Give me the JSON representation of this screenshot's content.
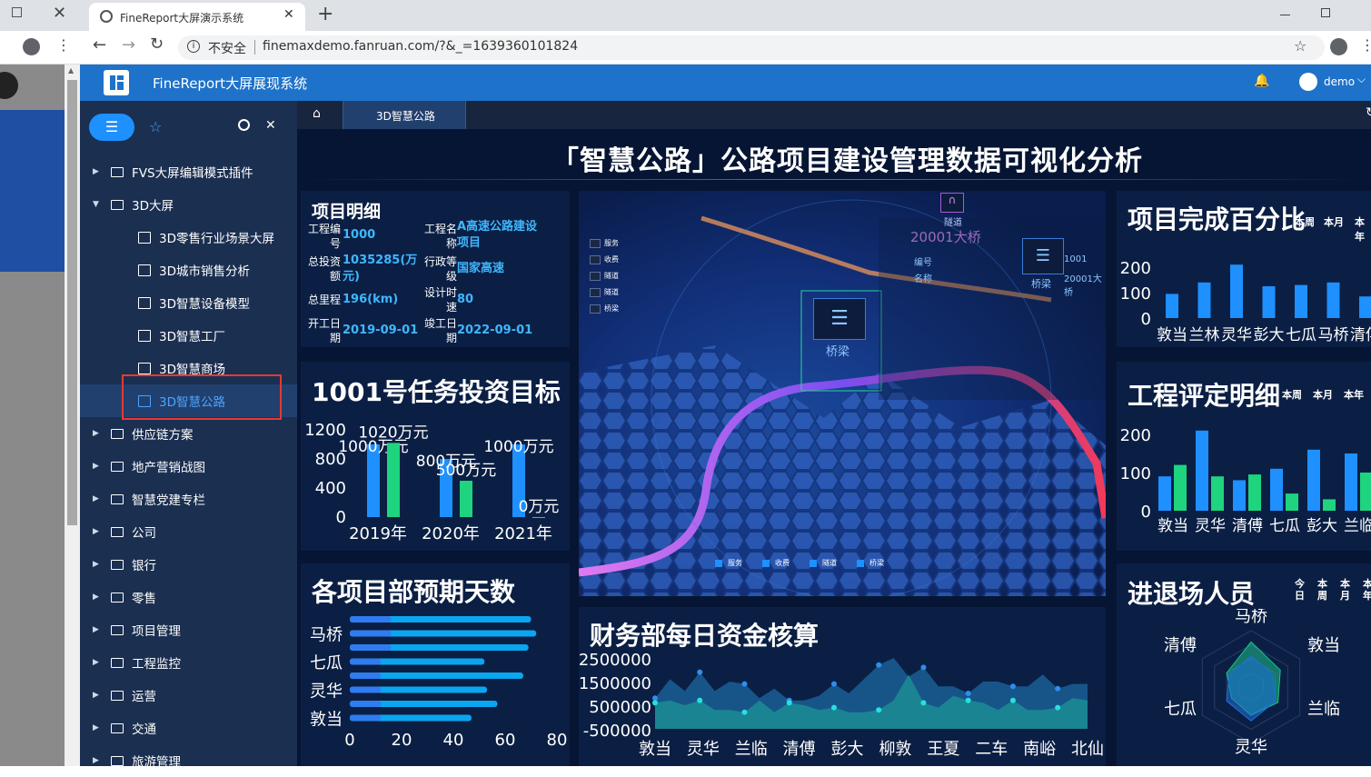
{
  "browser": {
    "tab_title": "FineReport大屏演示系统",
    "security": "不安全",
    "url": "finemaxdemo.fanruan.com/?&_=1639360101824"
  },
  "app": {
    "title": "FineReport大屏展现系统",
    "user": "demo"
  },
  "sidebar": {
    "items": [
      {
        "label": "FVS大屏编辑模式插件",
        "type": "folder",
        "expanded": false
      },
      {
        "label": "3D大屏",
        "type": "folder",
        "expanded": true
      },
      {
        "label": "3D零售行业场景大屏",
        "type": "file"
      },
      {
        "label": "3D城市销售分析",
        "type": "file"
      },
      {
        "label": "3D智慧设备模型",
        "type": "file"
      },
      {
        "label": "3D智慧工厂",
        "type": "file"
      },
      {
        "label": "3D智慧商场",
        "type": "file"
      },
      {
        "label": "3D智慧公路",
        "type": "file",
        "selected": true
      },
      {
        "label": "供应链方案",
        "type": "folder",
        "expanded": false
      },
      {
        "label": "地产营销战图",
        "type": "folder",
        "expanded": false
      },
      {
        "label": "智慧党建专栏",
        "type": "folder",
        "expanded": false
      },
      {
        "label": "公司",
        "type": "folder",
        "expanded": false
      },
      {
        "label": "银行",
        "type": "folder",
        "expanded": false
      },
      {
        "label": "零售",
        "type": "folder",
        "expanded": false
      },
      {
        "label": "项目管理",
        "type": "folder",
        "expanded": false
      },
      {
        "label": "工程监控",
        "type": "folder",
        "expanded": false
      },
      {
        "label": "运营",
        "type": "folder",
        "expanded": false
      },
      {
        "label": "交通",
        "type": "folder",
        "expanded": false
      },
      {
        "label": "旅游管理",
        "type": "folder",
        "expanded": false
      }
    ]
  },
  "nav": {
    "tab": "3D智慧公路"
  },
  "dashboard": {
    "title": "「智慧公路」公路项目建设管理数据可视化分析",
    "project": {
      "title": "项目明细",
      "rows": [
        {
          "l1a": "工程编",
          "l1b": "号",
          "v1": "1000",
          "l2a": "工程名",
          "l2b": "称",
          "v2a": "A高速公路建设",
          "v2b": "项目"
        },
        {
          "l1a": "总投资",
          "l1b": "额",
          "v1a": "1035285(万",
          "v1b": "元)",
          "l2a": "行政等",
          "l2b": "级",
          "v2": "国家高速"
        },
        {
          "l1a": "总里程",
          "v1": "196(km)",
          "l2a": "设计时",
          "l2b": "速",
          "v2": "80"
        },
        {
          "l1a": "开工日",
          "l1b": "期",
          "v1": "2019-09-01",
          "l2a": "竣工日",
          "l2b": "期",
          "v2": "2022-09-01"
        }
      ]
    },
    "map": {
      "legend": [
        "服务",
        "收费",
        "隧道",
        "桥梁"
      ],
      "side_legend": [
        "服务",
        "收费",
        "隧道",
        "隧道",
        "桥梁"
      ],
      "tunnel": "隧道",
      "bridge": "桥梁",
      "popup": {
        "id": "20001大桥",
        "num_label": "编号",
        "name_label": "名称",
        "num": "1001",
        "name": "20001大桥"
      }
    },
    "charts": {
      "invest": {
        "title": "1001号任务投资目标",
        "unit": "万元"
      },
      "days": {
        "title": "各项目部预期天数"
      },
      "finance": {
        "title": "财务部每日资金核算"
      },
      "complete": {
        "title": "项目完成百分比",
        "filters": [
          "本周",
          "本月",
          "本年"
        ]
      },
      "rating": {
        "title": "工程评定明细",
        "filters": [
          "本周",
          "本月",
          "本年"
        ]
      },
      "staff": {
        "title": "进退场人员",
        "filters": [
          "今日",
          "本周",
          "本月",
          "本年"
        ]
      }
    }
  },
  "chart_data": [
    {
      "type": "bar",
      "title": "1001号任务投资目标",
      "categories": [
        "2019年",
        "2020年",
        "2021年"
      ],
      "series": [
        {
          "values": [
            1000,
            800,
            1000
          ],
          "labels": [
            "1000万元",
            "800万元",
            "1000万元"
          ]
        },
        {
          "values": [
            1020,
            500,
            0
          ],
          "labels": [
            "1020万元",
            "500万元",
            "0万元"
          ]
        }
      ],
      "ylim": [
        0,
        1200
      ],
      "yticks": [
        0,
        400,
        800,
        1200
      ],
      "colors": [
        "#1e90ff",
        "#1ed47e"
      ]
    },
    {
      "type": "bar",
      "title": "各项目部预期天数",
      "orientation": "horizontal",
      "categories": [
        "敦当",
        "",
        "灵华",
        "",
        "七瓜",
        "",
        "马桥",
        ""
      ],
      "values": [
        70,
        72,
        69,
        52,
        67,
        53,
        57,
        47
      ],
      "highlight": [
        16,
        16,
        16,
        12,
        12,
        12,
        12,
        12
      ],
      "xlim": [
        0,
        80
      ],
      "xticks": [
        0,
        20,
        40,
        60,
        80
      ],
      "colors": [
        "#2f7cf0",
        "#0aa6ef"
      ]
    },
    {
      "type": "area",
      "title": "财务部每日资金核算",
      "categories": [
        "敦当",
        "灵华",
        "兰临",
        "清傅",
        "彭大",
        "柳敦",
        "王夏",
        "二车",
        "南峪",
        "北仙"
      ],
      "series": [
        {
          "values": [
            800000,
            1600000,
            1100000,
            1900000,
            1100000,
            1500000,
            1400000,
            800000,
            1200000,
            700000,
            700000,
            900000,
            1400000,
            1000000,
            1600000,
            2200000,
            2500000,
            1700000,
            2100000,
            1300000,
            1300000,
            1000000,
            1500000,
            1500000,
            1300000,
            1300000,
            1800000,
            1200000,
            1400000,
            1400000
          ],
          "color": "#1f7ab8"
        },
        {
          "values": [
            600000,
            700000,
            500000,
            700000,
            300000,
            300000,
            200000,
            700000,
            200000,
            600000,
            500000,
            300000,
            400000,
            200000,
            200000,
            300000,
            700000,
            1800000,
            600000,
            400000,
            900000,
            700000,
            600000,
            300000,
            700000,
            300000,
            300000,
            400000,
            800000,
            700000
          ],
          "color": "#1ea39a"
        }
      ],
      "ylim": [
        -500000,
        2500000
      ],
      "yticks": [
        -500000,
        500000,
        1500000,
        2500000
      ]
    },
    {
      "type": "bar",
      "title": "项目完成百分比",
      "categories": [
        "敦当",
        "兰林",
        "灵华",
        "彭大",
        "七瓜",
        "马桥",
        "清傅"
      ],
      "values": [
        95,
        140,
        210,
        125,
        130,
        140,
        85
      ],
      "ylim": [
        0,
        200
      ],
      "yticks": [
        0,
        100,
        200
      ],
      "color": "#1e90ff"
    },
    {
      "type": "bar",
      "title": "工程评定明细",
      "categories": [
        "敦当",
        "灵华",
        "清傅",
        "七瓜",
        "彭大",
        "兰临"
      ],
      "series": [
        {
          "values": [
            90,
            210,
            80,
            110,
            160,
            150
          ],
          "color": "#1e90ff"
        },
        {
          "values": [
            120,
            90,
            95,
            45,
            30,
            100
          ],
          "color": "#1ed47e"
        }
      ],
      "ylim": [
        0,
        200
      ],
      "yticks": [
        0,
        100,
        200
      ]
    },
    {
      "type": "radar",
      "title": "进退场人员",
      "categories": [
        "马桥",
        "敦当",
        "兰临",
        "灵华",
        "七瓜",
        "清傅"
      ],
      "series": [
        {
          "values": [
            0.8,
            0.6,
            0.55,
            0.5,
            0.4,
            0.5
          ],
          "color": "#1ec08a"
        },
        {
          "values": [
            0.55,
            0.45,
            0.5,
            0.6,
            0.5,
            0.45
          ],
          "color": "#1e6fd9"
        }
      ]
    }
  ]
}
